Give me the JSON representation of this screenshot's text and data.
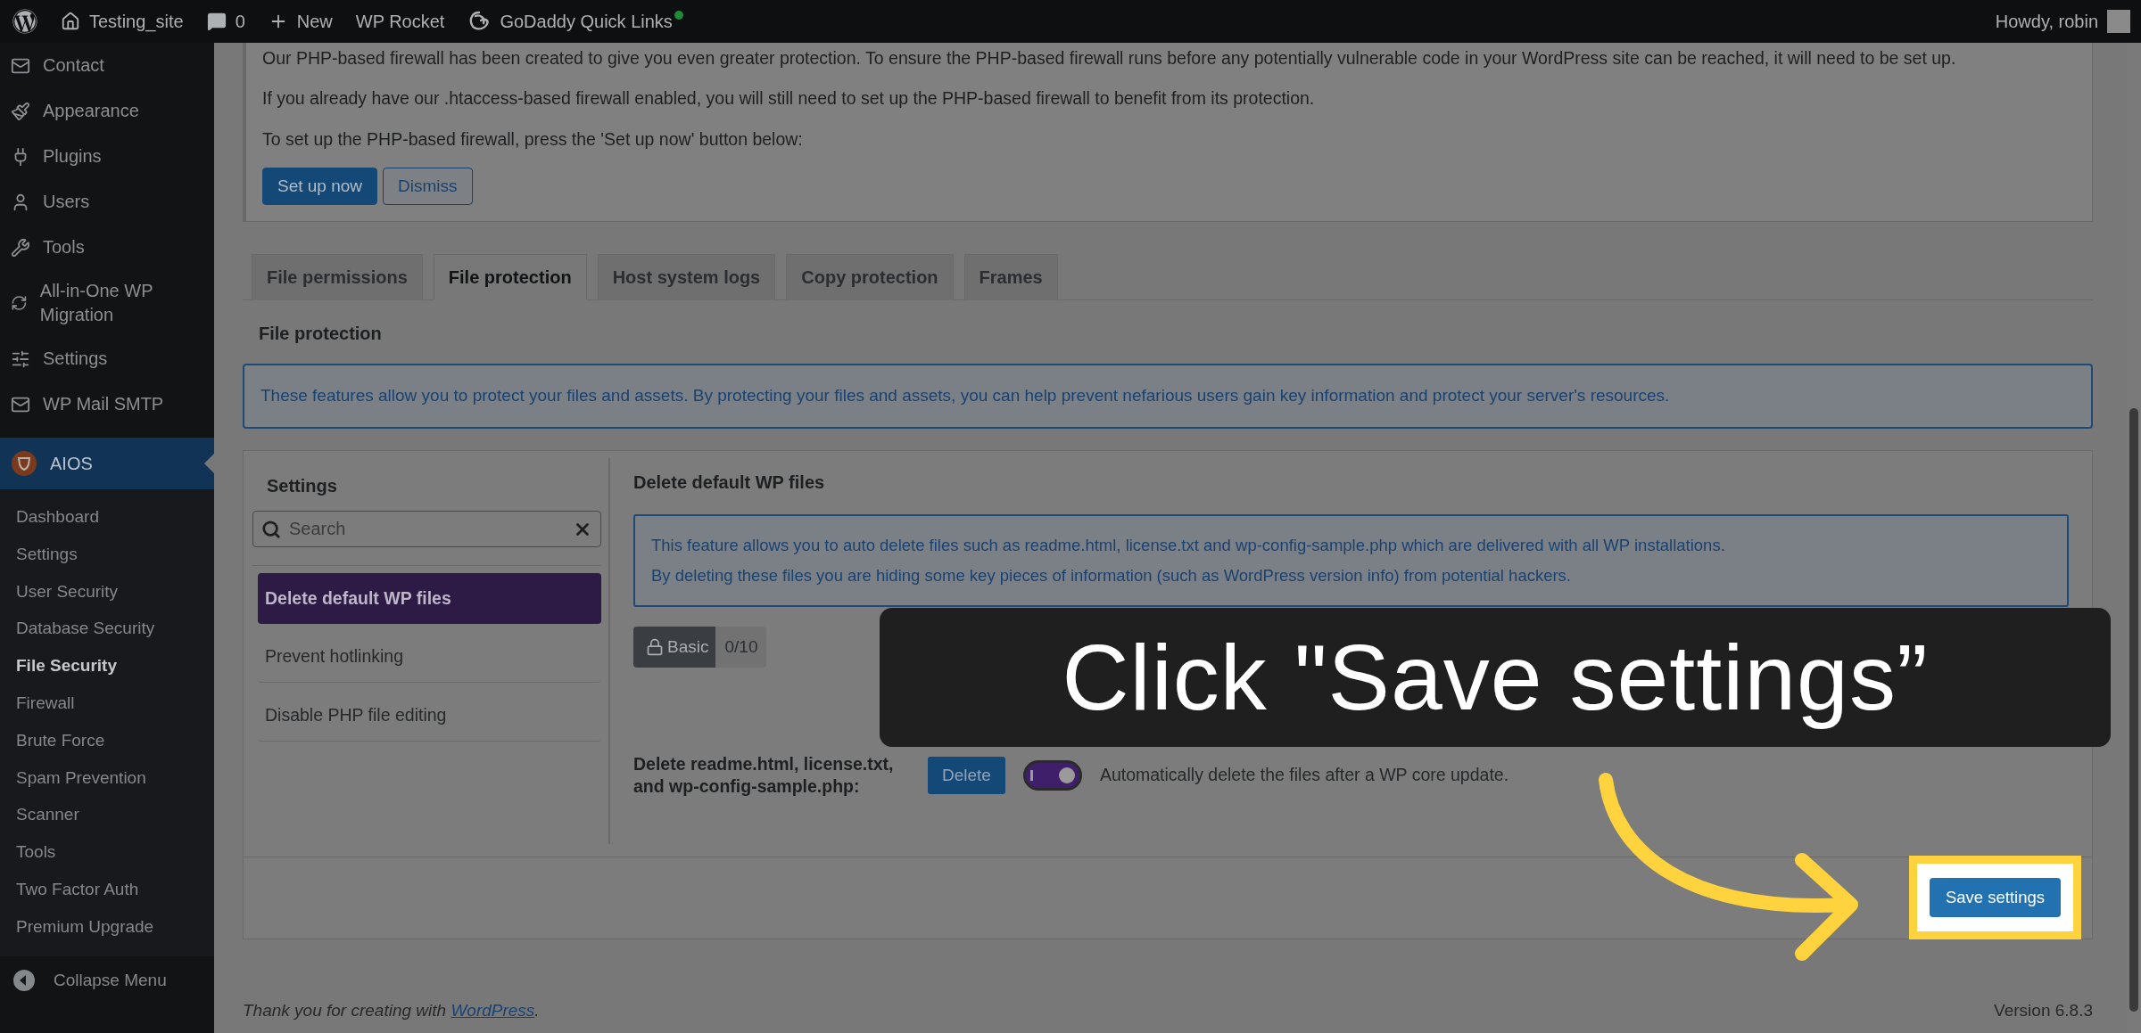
{
  "admin_bar": {
    "items": [
      {
        "label": "Testing_site"
      },
      {
        "label": "0"
      },
      {
        "label": "New"
      },
      {
        "label": "WP Rocket"
      },
      {
        "label": "GoDaddy Quick Links"
      }
    ],
    "greeting": "Howdy, robin"
  },
  "sidebar": {
    "items": [
      {
        "label": "Contact",
        "selected": false
      },
      {
        "label": "Appearance",
        "selected": false
      },
      {
        "label": "Plugins",
        "selected": false
      },
      {
        "label": "Users",
        "selected": false
      },
      {
        "label": "Tools",
        "selected": false
      },
      {
        "label": "All-in-One WP Migration",
        "selected": false
      },
      {
        "label": "Settings",
        "selected": false
      },
      {
        "label": "WP Mail SMTP",
        "selected": false
      },
      {
        "label": "AIOS",
        "selected": true
      }
    ],
    "submenu": [
      {
        "label": "Dashboard",
        "selected": false
      },
      {
        "label": "Settings",
        "selected": false
      },
      {
        "label": "User Security",
        "selected": false
      },
      {
        "label": "Database Security",
        "selected": false
      },
      {
        "label": "File Security",
        "selected": true
      },
      {
        "label": "Firewall",
        "selected": false
      },
      {
        "label": "Brute Force",
        "selected": false
      },
      {
        "label": "Spam Prevention",
        "selected": false
      },
      {
        "label": "Scanner",
        "selected": false
      },
      {
        "label": "Tools",
        "selected": false
      },
      {
        "label": "Two Factor Auth",
        "selected": false
      },
      {
        "label": "Premium Upgrade",
        "selected": false
      }
    ],
    "collapse": "Collapse Menu"
  },
  "notice": {
    "paragraphs": [
      "Our PHP-based firewall has been created to give you even greater protection. To ensure the PHP-based firewall runs before any potentially vulnerable code in your WordPress site can be reached, it will need to be set up.",
      "If you already have our .htaccess-based firewall enabled, you will still need to set up the PHP-based firewall to benefit from its protection.",
      "To set up the PHP-based firewall, press the 'Set up now' button below:"
    ],
    "primary_button": "Set up now",
    "secondary_button": "Dismiss"
  },
  "tabs": [
    {
      "label": "File permissions",
      "selected": false
    },
    {
      "label": "File protection",
      "selected": true
    },
    {
      "label": "Host system logs",
      "selected": false
    },
    {
      "label": "Copy protection",
      "selected": false
    },
    {
      "label": "Frames",
      "selected": false
    }
  ],
  "section_title": "File protection",
  "info": "These features allow you to protect your files and assets. By protecting your files and assets, you can help prevent nefarious users gain key information and protect your server's resources.",
  "settings_panel": {
    "title": "Settings",
    "search": {
      "placeholder": "Search"
    },
    "items": [
      {
        "label": "Delete default WP files",
        "selected": true
      },
      {
        "label": "Prevent hotlinking",
        "selected": false
      },
      {
        "label": "Disable PHP file editing",
        "selected": false
      }
    ],
    "detail": {
      "title": "Delete default WP files",
      "info": [
        "This feature allows you to auto delete files such as readme.html, license.txt and wp-config-sample.php which are delivered with all WP installations.",
        "By deleting these files you are hiding some key pieces of information (such as WordPress version info) from potential hackers."
      ],
      "badge": {
        "label": "Basic",
        "score": "0/10"
      },
      "option": {
        "label": "Delete readme.html, license.txt, and wp-config-sample.php:",
        "button": "Delete",
        "toggle": {
          "on": true
        },
        "toggle_label": "Automatically delete the files after a WP core update."
      }
    },
    "save_button": "Save settings"
  },
  "footer": {
    "thanks": "Thank you for creating with ",
    "link": "WordPress",
    "suffix": ".",
    "version": "Version 6.8.3"
  },
  "tutorial": {
    "callout": "Click \"Save settings”"
  }
}
